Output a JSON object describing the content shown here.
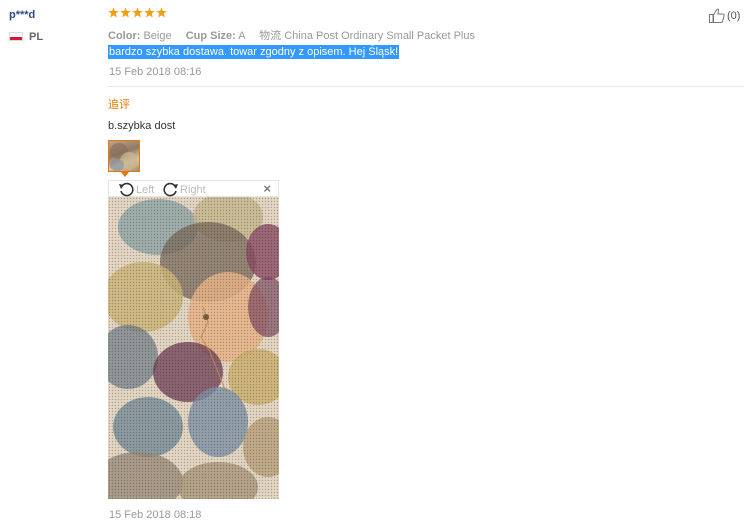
{
  "user": {
    "name": "p***d",
    "country": "PL"
  },
  "rating": {
    "stars": 5,
    "star_color": "#f39c12"
  },
  "attributes": [
    {
      "key": "Color:",
      "value": "Beige"
    },
    {
      "key": "Cup Size:",
      "value": "A"
    },
    {
      "key": "物流",
      "value": "China Post Ordinary Small Packet Plus"
    }
  ],
  "review": {
    "text": "bardzo szybka dostawa. towar zgodny z opisem. Hej Śląsk!",
    "date": "15 Feb 2018 08:16"
  },
  "helpful": {
    "count": "(0)",
    "icon": "thumbs-up-icon"
  },
  "followup": {
    "label": "追评",
    "text": "b.szybka dost",
    "date": "15 Feb 2018 08:18"
  },
  "viewer": {
    "rotate_left": "Left",
    "rotate_right": "Right",
    "close": "×"
  },
  "colors": {
    "accent": "#e67700",
    "link": "#2a4a8a",
    "selection": "#3399ff"
  }
}
